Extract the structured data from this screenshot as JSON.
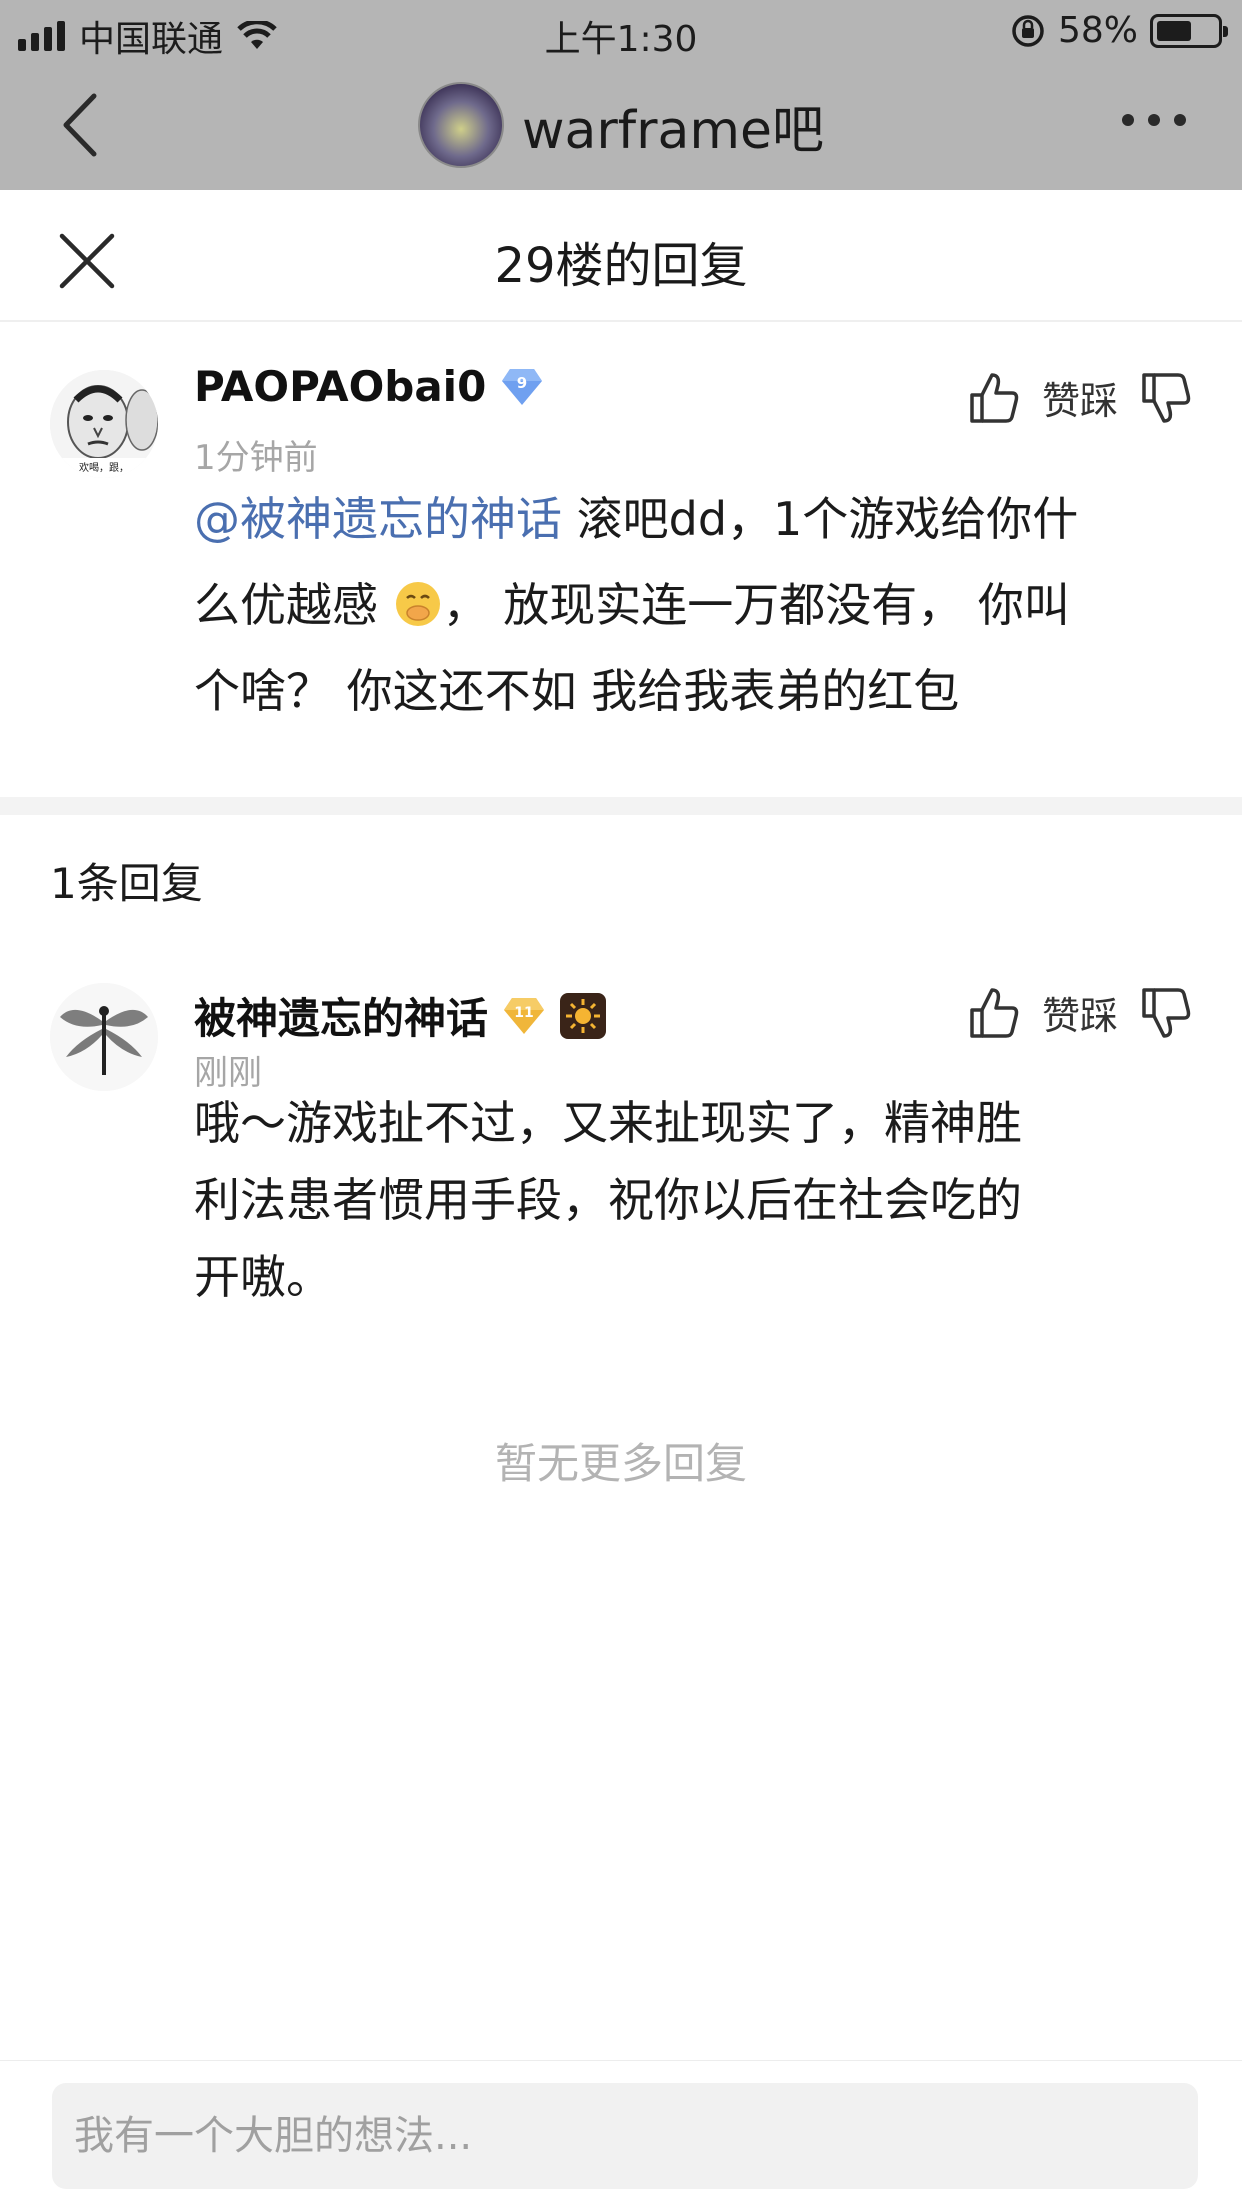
{
  "status_bar": {
    "carrier": "中国联通",
    "time": "上午1:30",
    "battery_percent": "58%",
    "battery_level": 0.58
  },
  "nav": {
    "title": "warframe吧"
  },
  "sheet": {
    "title": "29楼的回复"
  },
  "main_post": {
    "username": "PAOPAObai0",
    "level": "9",
    "timestamp": "1分钟前",
    "vote_label": "赞踩",
    "mention": "@被神遗忘的神话",
    "line1_rest": " 滚吧dd，1个游戏给你什",
    "line2": "么优越感",
    "line2_rest": "， 放现实连一万都没有， 你叫",
    "line3": "个啥？ 你这还不如 我给我表弟的红包",
    "avatar_caption": "欢喝，跟，"
  },
  "replies": {
    "count_label": "1条回复",
    "items": [
      {
        "username": "被神遗忘的神话",
        "level": "11",
        "timestamp": "刚刚",
        "vote_label": "赞踩",
        "line1": "哦～游戏扯不过，又来扯现实了，精神胜",
        "line2": "利法患者惯用手段，祝你以后在社会吃的",
        "line3": "开嗷。"
      }
    ],
    "no_more": "暂无更多回复"
  },
  "input": {
    "placeholder": "我有一个大胆的想法..."
  },
  "colors": {
    "mention": "#4a6fb0",
    "level_badge_blue": "#6fa0f0",
    "level_badge_gold": "#f0b63a"
  }
}
